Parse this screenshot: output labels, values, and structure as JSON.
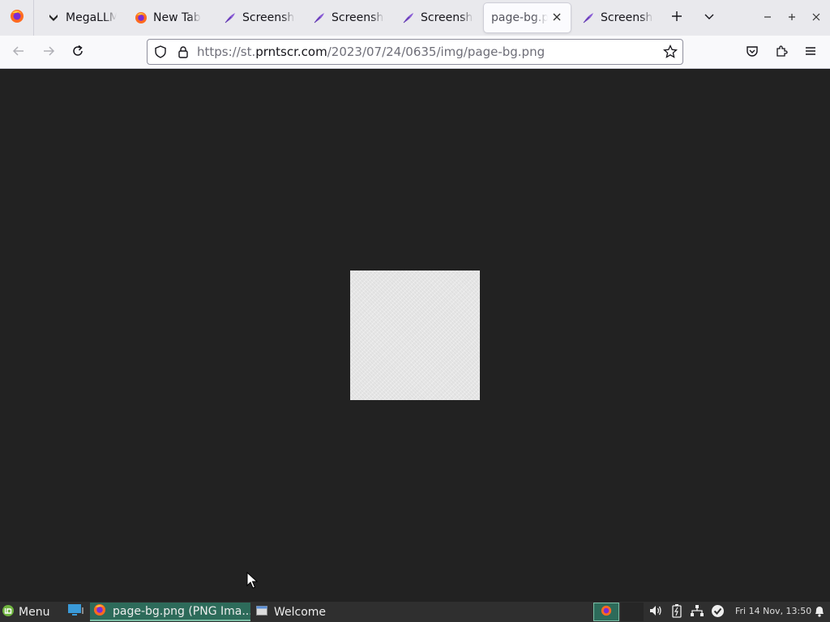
{
  "browser": {
    "tabs": [
      {
        "label": "MegaLLM",
        "icon": "megallm-favicon-icon"
      },
      {
        "label": "New Tab",
        "icon": "firefox-icon"
      },
      {
        "label": "Screenshot",
        "icon": "feather-icon"
      },
      {
        "label": "Screenshot",
        "icon": "feather-icon"
      },
      {
        "label": "Screenshot",
        "icon": "feather-icon"
      },
      {
        "label": "page-bg.png",
        "icon": "image-icon",
        "active": true
      },
      {
        "label": "Screenshot",
        "icon": "feather-icon"
      }
    ],
    "url": {
      "prefix": "https://st.",
      "domain": "prntscr.com",
      "path": "/2023/07/24/0635/img/page-bg.png"
    }
  },
  "taskbar": {
    "menu_label": "Menu",
    "windows": [
      {
        "label": "page-bg.png (PNG Ima...",
        "icon": "firefox-icon",
        "active": true
      },
      {
        "label": "Welcome",
        "icon": "window-icon",
        "active": false
      }
    ],
    "clock": "Fri 14 Nov, 13:50"
  },
  "colors": {
    "content_bg": "#222222",
    "tab_strip_bg": "#e9e9ed",
    "taskbar_bg": "#2f2f2f",
    "taskbar_active": "#2d6b5a",
    "feather_icon": "#8a5cd6"
  }
}
